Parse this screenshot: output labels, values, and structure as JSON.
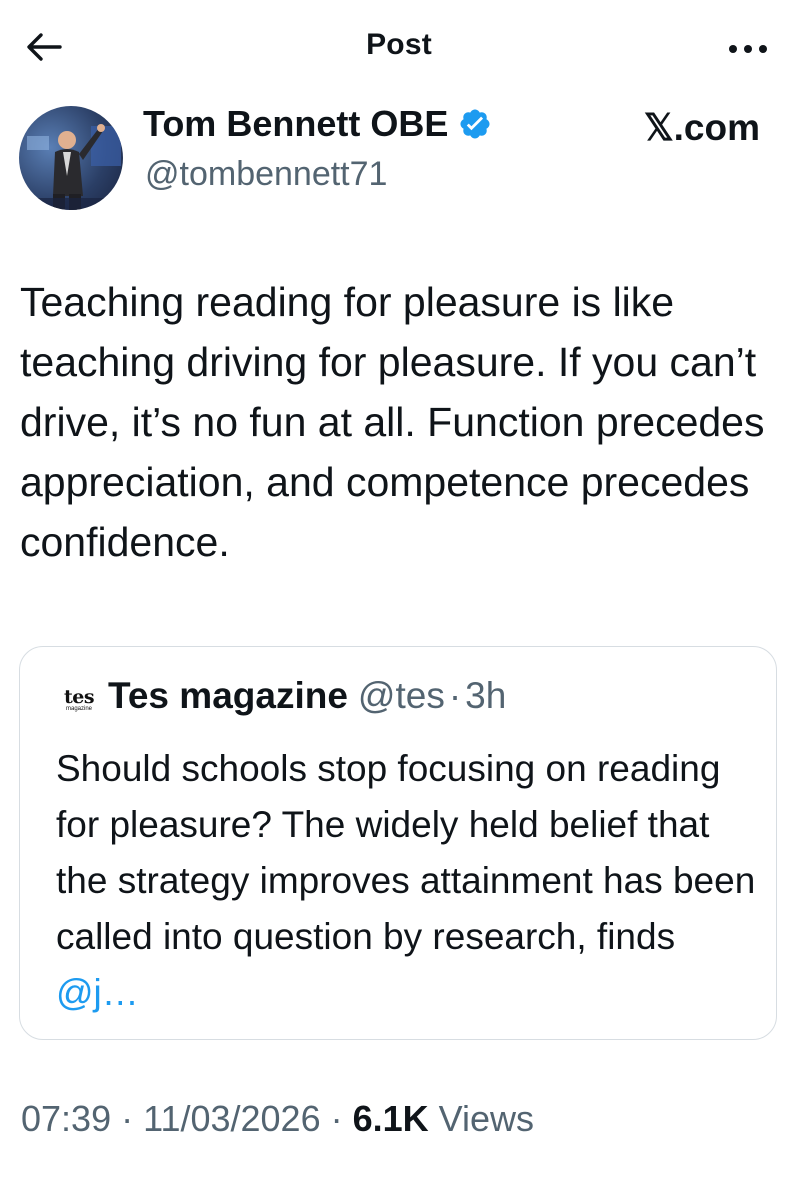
{
  "header": {
    "title": "Post",
    "back_icon": "arrow-left-icon",
    "more_icon": "more-horizontal-icon"
  },
  "author": {
    "name": "Tom Bennett OBE",
    "handle": "@tombennett71",
    "verified": true,
    "verified_color": "#1d9bf0",
    "avatar_icon": "avatar-photo"
  },
  "source": {
    "label": "𝕏.com"
  },
  "post": {
    "text": "Teaching reading for pleasure is like teaching driving for pleasure. If you can’t drive, it’s no fun at all. Function precedes appreciation, and competence precedes confidence."
  },
  "quote": {
    "avatar_text": "tes",
    "avatar_subtext": "magazine",
    "name": "Tes magazine",
    "handle": "@tes",
    "separator": "·",
    "time": "3h",
    "text": "Should schools stop focusing on reading for pleasure? The widely held belief that the strategy improves attainment has been called into question by research, finds ",
    "mention": "@j…"
  },
  "meta": {
    "time": "07:39",
    "separator": " · ",
    "date": "11/03/2026",
    "separator2": " · ",
    "views_count": "6.1K",
    "views_label": " Views"
  },
  "colors": {
    "text_primary": "#0f1419",
    "text_secondary": "#536471",
    "accent": "#1d9bf0",
    "border": "#d7dde2"
  }
}
